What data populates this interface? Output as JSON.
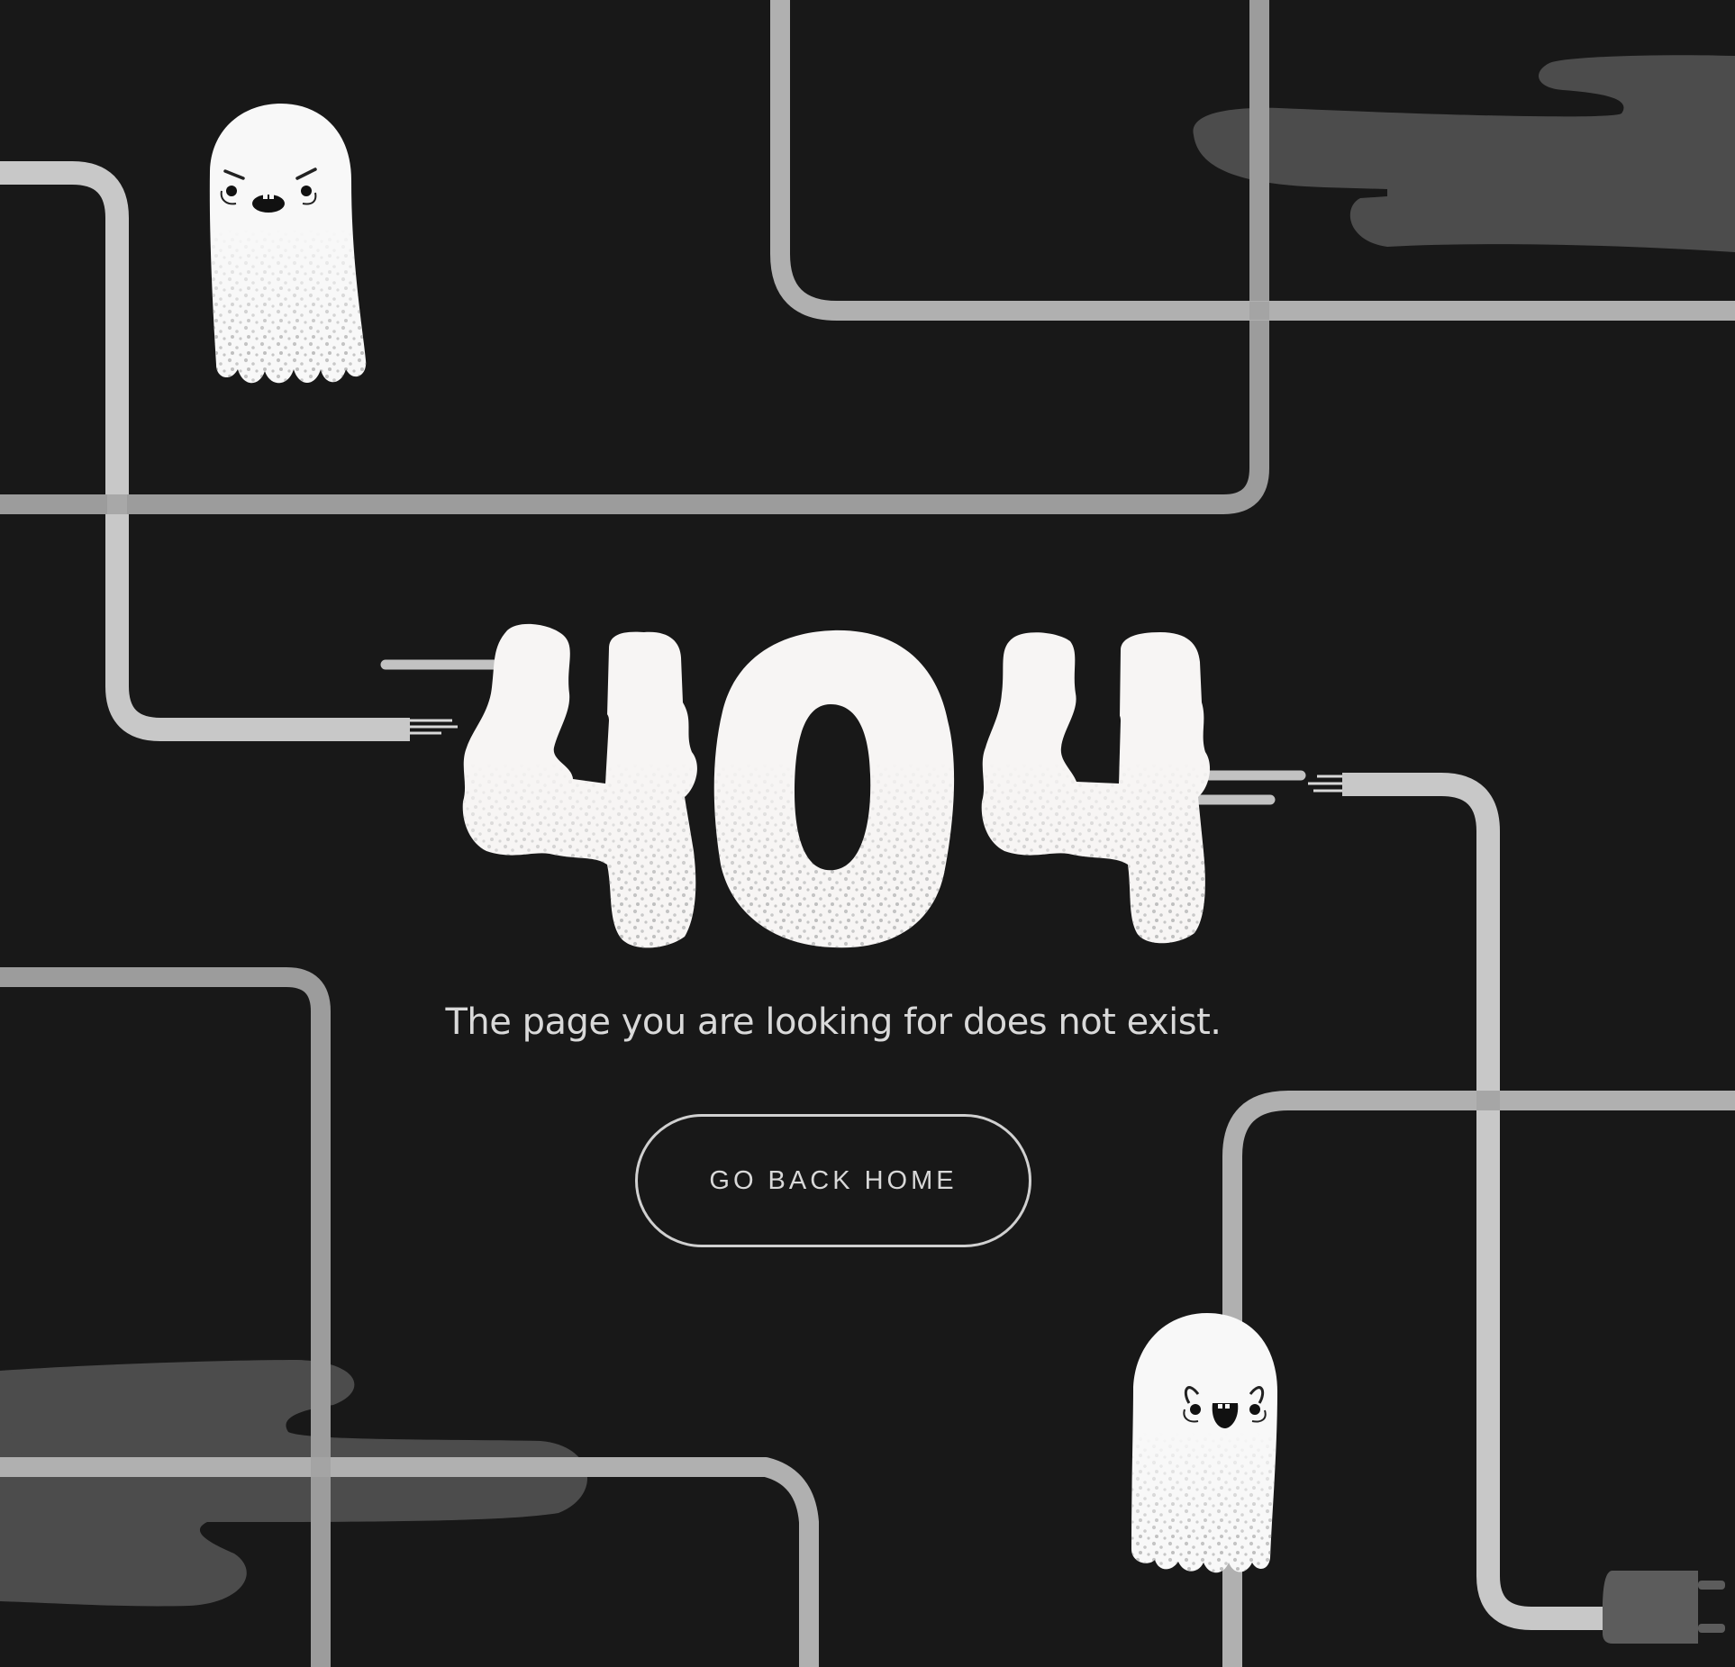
{
  "error": {
    "code": "404",
    "message": "The page you are looking for does not exist."
  },
  "actions": {
    "home_label": "GO BACK HOME"
  },
  "colors": {
    "background": "#181818",
    "cable_light": "#c8c8c8",
    "cable_mid": "#b0b0b0",
    "cable_dark": "#9c9c9c",
    "smoke": "#4c4c4c",
    "ghost": "#f8f8f8",
    "number_fill": "#f7f5f4",
    "text": "#d9d9d9"
  },
  "icons": {
    "ghost_top": "angry-ghost-icon",
    "ghost_bottom": "happy-ghost-icon",
    "plug": "power-plug-icon"
  }
}
